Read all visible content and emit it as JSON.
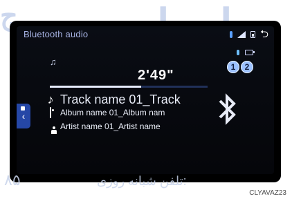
{
  "header": {
    "title": "Bluetooth audio"
  },
  "player": {
    "time": "2'49\"",
    "progress_fraction": 0.58,
    "track": "Track name 01_Track",
    "album": "Album name 01_Album nam",
    "artist": "Artist name 01_Artist name"
  },
  "devices": [
    {
      "label": "1"
    },
    {
      "label": "2"
    }
  ],
  "watermark": {
    "big": "ﺍﻣﺪﺍﺩ ﺧﻮ",
    "left": "ﺝ",
    "text": "تلفن شبانه روزی:",
    "digits": "۸۵"
  },
  "figure_code": "CLYAVAZ23",
  "icons": {
    "back": "back-arrow-icon",
    "bluetooth": "bluetooth-icon",
    "music": "music-note-icon"
  },
  "colors": {
    "screen_background": "#05060a",
    "accent_blue": "#2547a6",
    "title_text": "#a9b5e6"
  }
}
